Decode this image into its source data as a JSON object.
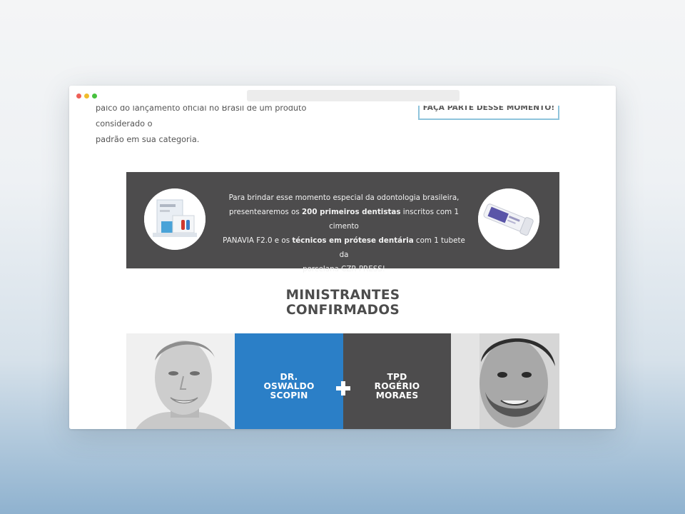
{
  "intro": {
    "line1": "palco do lançamento oficial no Brasil de um produto considerado o",
    "line2": "padrão em sua categoria."
  },
  "cta": {
    "label": "FAÇA PARTE DESSE MOMENTO!"
  },
  "gift": {
    "l1": "Para brindar esse momento especial da odontologia brasileira,",
    "l2_a": "presentearemos os ",
    "l2_b": "200 primeiros dentistas",
    "l2_c": " inscritos com 1 cimento",
    "l3_a": "PANAVIA F2.0 e os ",
    "l3_b": "técnicos em prótese dentária",
    "l3_c": " com 1 tubete da",
    "l4": "porcelana CZR PRESS!"
  },
  "section": {
    "title_l1": "MINISTRANTES",
    "title_l2": "CONFIRMADOS"
  },
  "speakers": [
    {
      "line1": "DR.",
      "line2": "OSWALDO",
      "line3": "SCOPIN"
    },
    {
      "line1": "TPD",
      "line2": "ROGÉRIO",
      "line3": "MORAES"
    }
  ],
  "colors": {
    "blue": "#2b7fc7",
    "dark": "#4d4c4d",
    "cta_border": "#8fc4dc"
  }
}
